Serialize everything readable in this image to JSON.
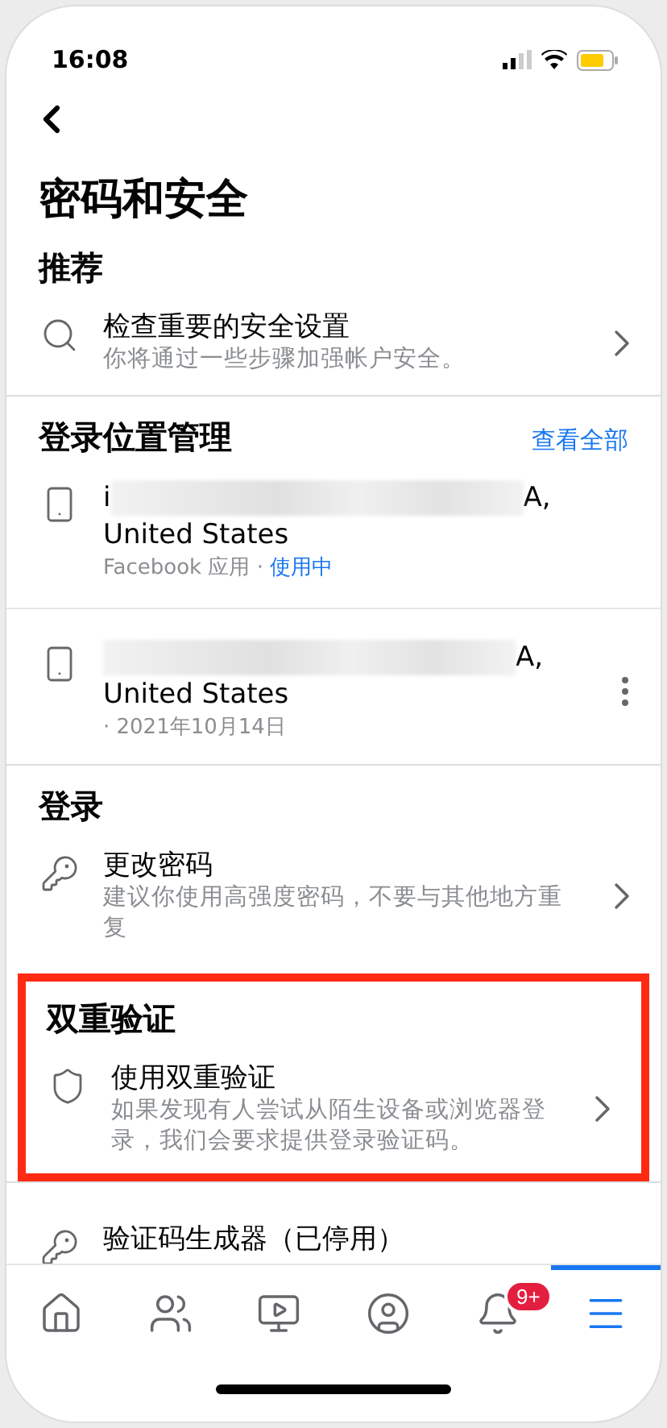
{
  "status_bar": {
    "time": "16:08"
  },
  "title": "密码和安全",
  "sections": [
    {
      "heading": "推荐",
      "highlighted": false,
      "items": [
        {
          "kind": "checkup",
          "title": "检查重要的安全设置",
          "subtitle": "你将通过一些步骤加强帐户安全。"
        }
      ]
    },
    {
      "heading": "登录位置管理",
      "link": "查看全部",
      "highlighted": false,
      "items": [
        {
          "kind": "device",
          "title_start": "i",
          "title_end": "A,",
          "title_line2": "United States",
          "meta": "Facebook 应用 ·",
          "status": "使用中",
          "menu": false
        },
        {
          "kind": "device",
          "title_end": "A,",
          "title_line2": "United States",
          "meta": "· 2021年10月14日",
          "menu": true
        }
      ]
    },
    {
      "heading": "登录",
      "highlighted": false,
      "items": [
        {
          "kind": "key",
          "title": "更改密码",
          "subtitle": "建议你使用高强度密码，不要与其他地方重复"
        }
      ]
    },
    {
      "heading": "双重验证",
      "highlighted": true,
      "items": [
        {
          "kind": "shield",
          "title": "使用双重验证",
          "subtitle": "如果发现有人尝试从陌生设备或浏览器登录，我们会要求提供登录验证码。"
        }
      ]
    },
    {
      "items": [
        {
          "kind": "generator",
          "title": "验证码生成器（已停用）"
        }
      ]
    }
  ],
  "tab_bar": [
    {
      "selected": false
    },
    {
      "selected": false
    },
    {
      "selected": false
    },
    {
      "selected": false
    },
    {
      "selected": false,
      "badge": "9+"
    },
    {
      "selected": true
    }
  ]
}
